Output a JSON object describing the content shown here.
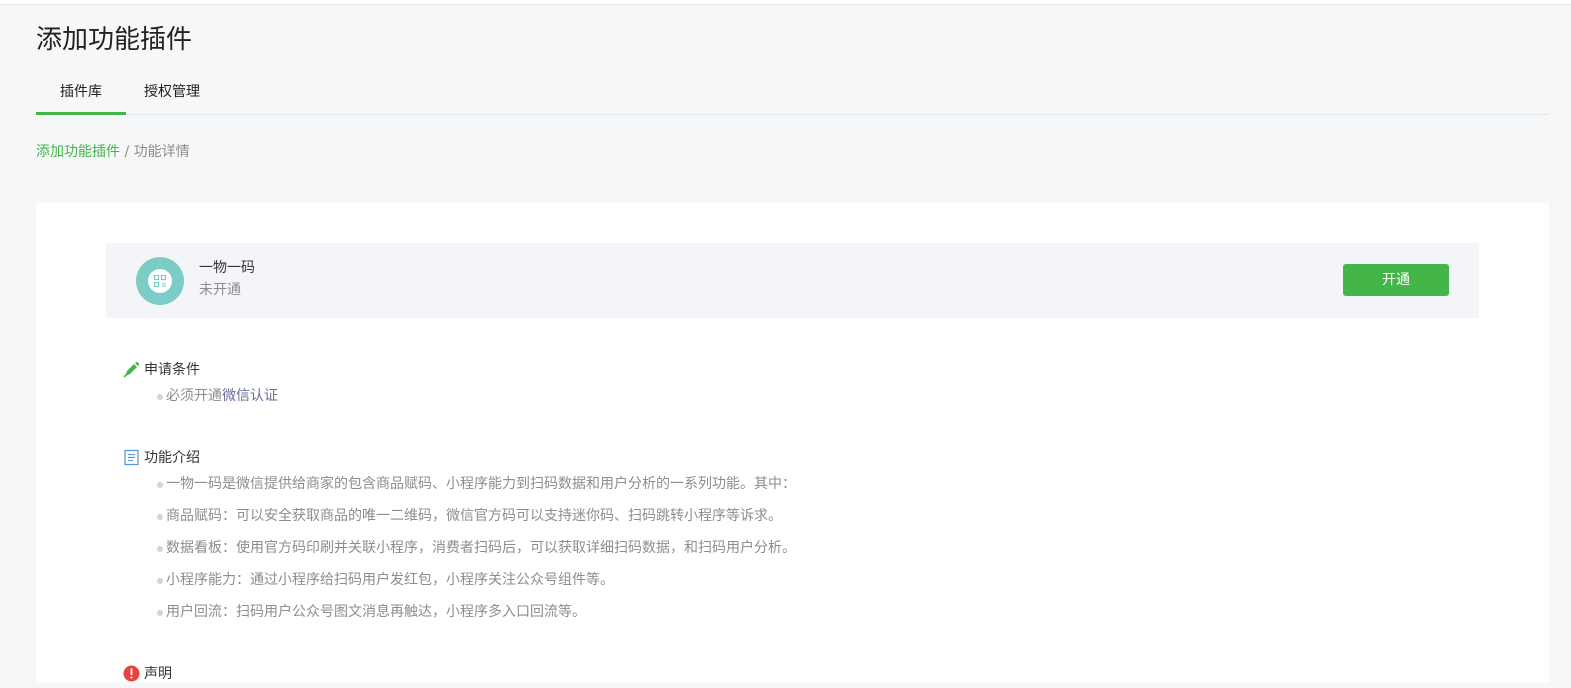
{
  "page": {
    "title": "添加功能插件"
  },
  "tabs": [
    {
      "label": "插件库",
      "active": true
    },
    {
      "label": "授权管理",
      "active": false
    }
  ],
  "breadcrumb": {
    "parent": "添加功能插件",
    "separator": " / ",
    "current": "功能详情"
  },
  "plugin": {
    "name": "一物一码",
    "status": "未开通",
    "icon": "qrcode-icon",
    "action_label": "开通"
  },
  "sections": {
    "requirements": {
      "title": "申请条件",
      "icon": "pencil-icon",
      "item_prefix": "必须开通",
      "item_link": "微信认证"
    },
    "intro": {
      "title": "功能介绍",
      "icon": "document-icon",
      "items": [
        "一物一码是微信提供给商家的包含商品赋码、小程序能力到扫码数据和用户分析的一系列功能。其中：",
        "商品赋码：可以安全获取商品的唯一二维码，微信官方码可以支持迷你码、扫码跳转小程序等诉求。",
        "数据看板：使用官方码印刷并关联小程序，消费者扫码后，可以获取详细扫码数据，和扫码用户分析。",
        "小程序能力：通过小程序给扫码用户发红包，小程序关注公众号组件等。",
        "用户回流：扫码用户公众号图文消息再触达，小程序多入口回流等。"
      ]
    },
    "statement": {
      "title": "声明",
      "icon": "alert-icon"
    }
  },
  "colors": {
    "accent": "#44b549",
    "icon_bg": "#7ccdc6",
    "alert": "#e64340",
    "doc_icon": "#5c9ad6"
  }
}
